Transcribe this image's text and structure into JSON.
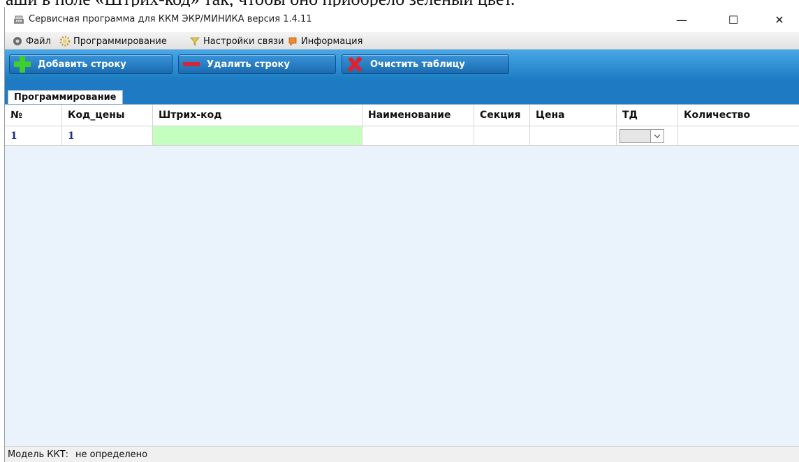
{
  "window": {
    "title": "Сервисная программа для ККМ ЭКР/МИНИКА версия 1.4.11",
    "minimize": "—",
    "maximize": "☐",
    "close": "✕"
  },
  "document_caption": "аши в поле «Штрих-код» так, чтобы оно приобрело зеленый цвет.",
  "menu": {
    "items": [
      {
        "label": "Файл",
        "icon": "file-gear-icon"
      },
      {
        "label": "Программирование",
        "icon": "gear-icon"
      },
      {
        "label": "Настройки связи",
        "icon": "funnel-icon"
      },
      {
        "label": "Информация",
        "icon": "info-bubble-icon"
      }
    ]
  },
  "toolbar": {
    "add_row": "Добавить строку",
    "delete_row": "Удалить строку",
    "clear_table": "Очистить таблицу"
  },
  "tabs": [
    {
      "label": "Программирование",
      "active": true
    }
  ],
  "grid": {
    "columns": [
      "№",
      "Код_цены",
      "Штрих-код",
      "Наименование",
      "Секция",
      "Цена",
      "ТД",
      "Количество"
    ],
    "rows": [
      {
        "num": "1",
        "price_code": "1",
        "barcode": "",
        "name": "",
        "section": "",
        "price": "",
        "td": "",
        "quantity": ""
      }
    ]
  },
  "status": {
    "label": "Модель ККТ:",
    "value": "не определено"
  },
  "colors": {
    "toolbar": "#1b7cc2",
    "barcode_highlight": "#c5ffc0",
    "grid_background": "#eaf2fb",
    "row_text": "#1a2e8a"
  }
}
